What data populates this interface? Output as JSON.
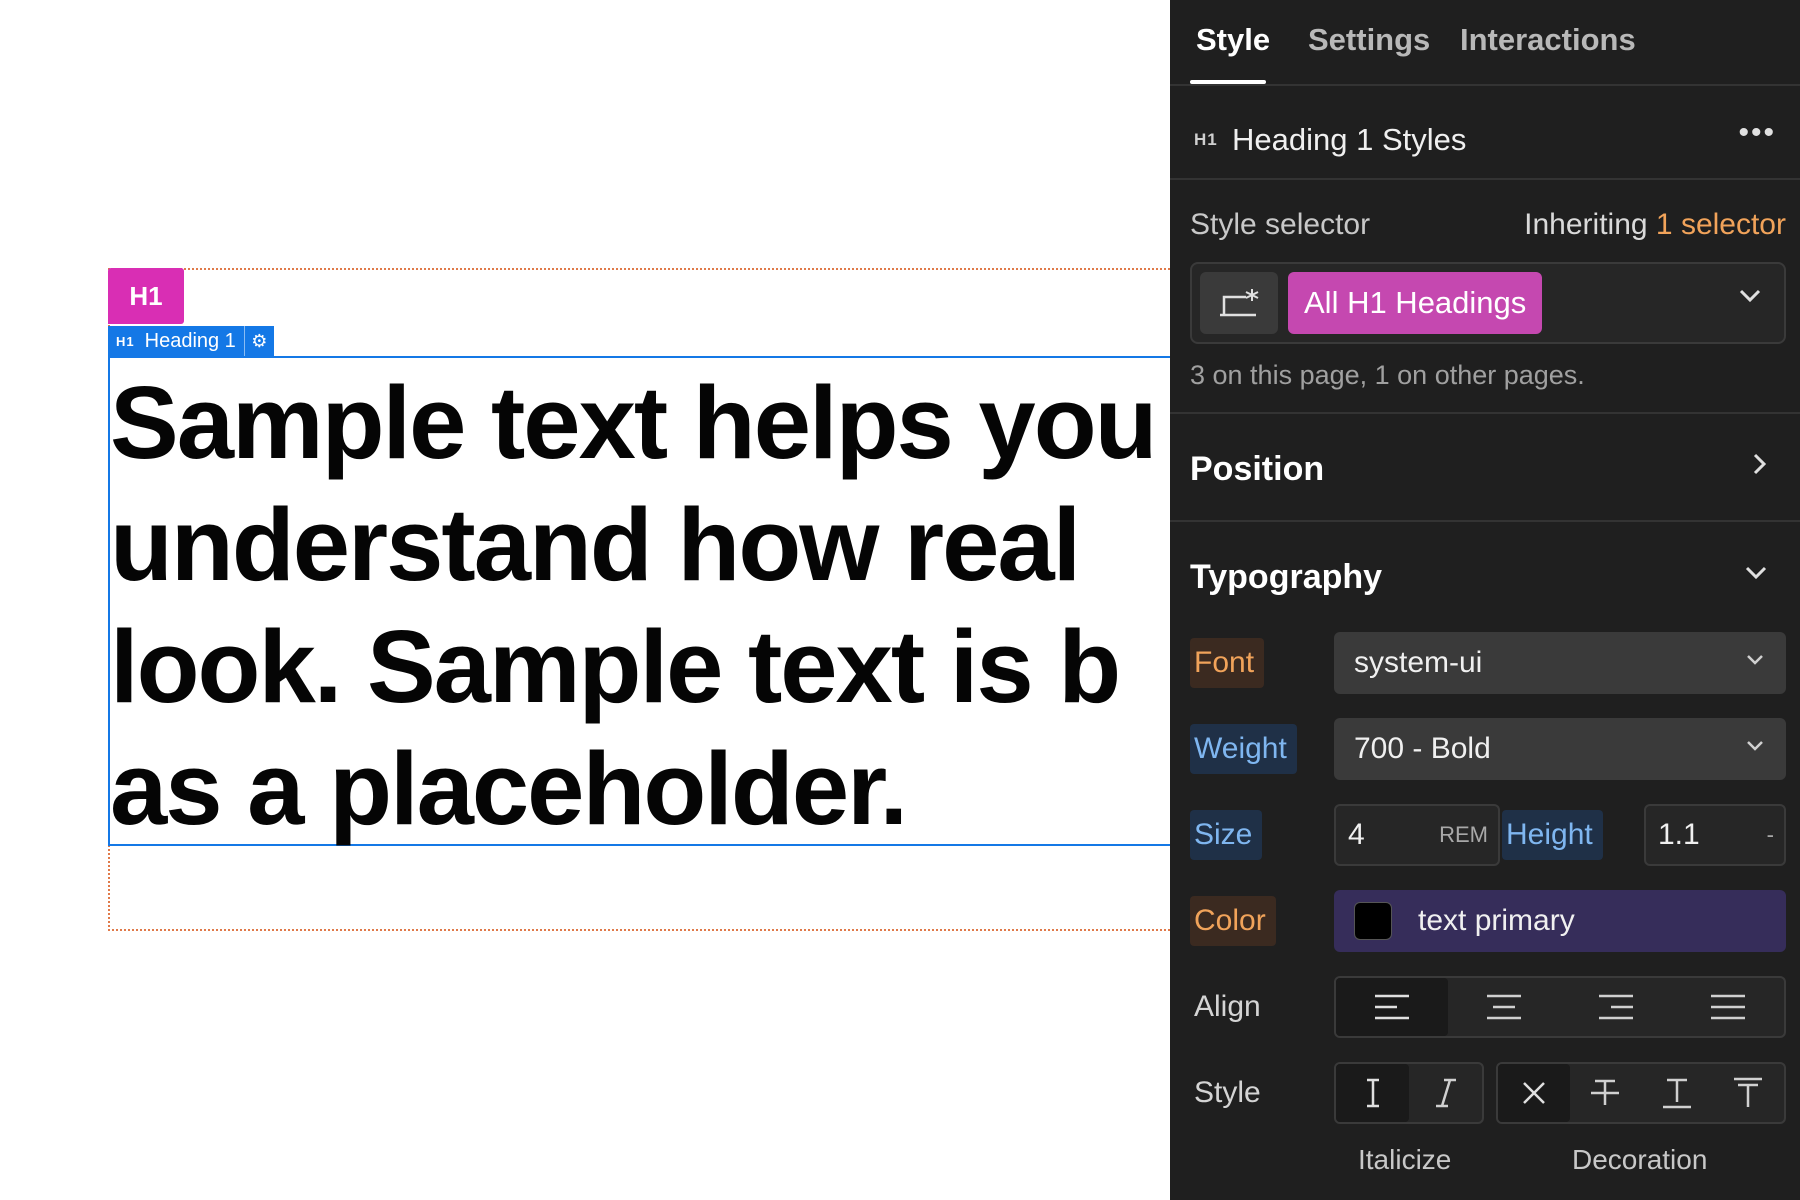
{
  "canvas": {
    "tag_badge": "H1",
    "selection_label": {
      "badge": "H1",
      "name": "Heading 1"
    },
    "heading_lines": [
      "Sample text helps you",
      "understand how real",
      "look. Sample text is b",
      "as a placeholder."
    ]
  },
  "panel": {
    "tabs": [
      {
        "label": "Style",
        "active": true
      },
      {
        "label": "Settings",
        "active": false
      },
      {
        "label": "Interactions",
        "active": false
      }
    ],
    "title_badge": "H1",
    "title": "Heading 1 Styles",
    "style_selector": {
      "label": "Style selector",
      "inheriting_prefix": "Inheriting",
      "inheriting_count": "1 selector",
      "pill": "All H1 Headings",
      "hint": "3 on this page, 1 on other pages."
    },
    "position": {
      "title": "Position"
    },
    "typography": {
      "title": "Typography",
      "font_label": "Font",
      "font_value": "system-ui",
      "weight_label": "Weight",
      "weight_value": "700 - Bold",
      "size_label": "Size",
      "size_value": "4",
      "size_unit": "REM",
      "height_label": "Height",
      "height_value": "1.1",
      "height_unit": "-",
      "color_label": "Color",
      "color_value": "text primary",
      "color_swatch": "#000000",
      "align_label": "Align",
      "style_label": "Style",
      "italicize_label": "Italicize",
      "decoration_label": "Decoration"
    }
  }
}
